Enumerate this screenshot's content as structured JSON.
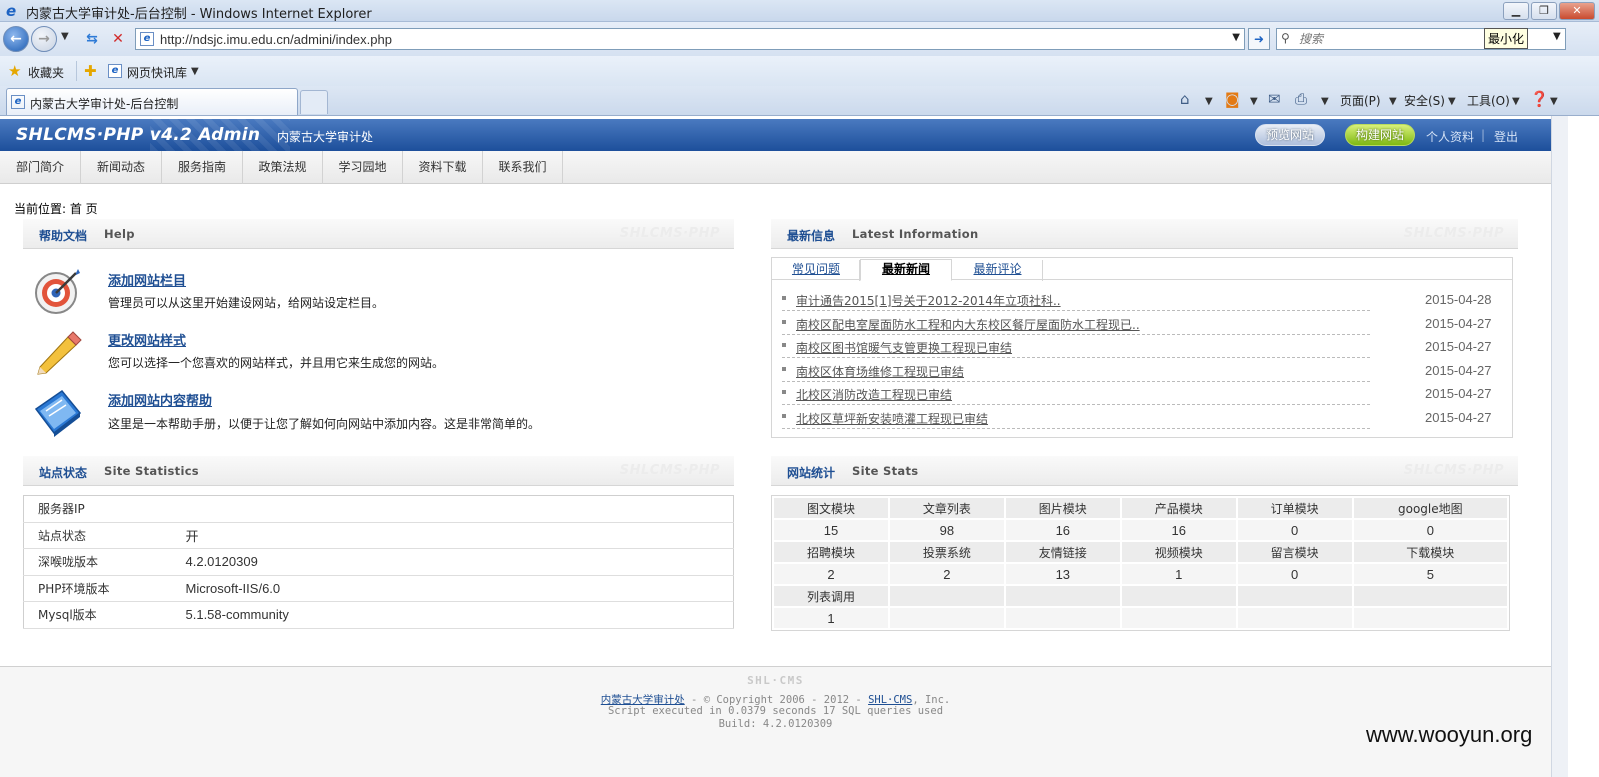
{
  "window": {
    "title": "内蒙古大学审计处-后台控制 - Windows Internet Explorer",
    "min_btn": "▁",
    "max_btn": "❐",
    "close_btn": "✕"
  },
  "address": {
    "url": "http://ndsjc.imu.edu.cn/admini/index.php",
    "search_placeholder": "搜索",
    "tooltip": "最小化"
  },
  "favorites": {
    "label": "收藏夹",
    "slice_label": "网页快讯库"
  },
  "tabs": {
    "active_title": "内蒙古大学审计处-后台控制"
  },
  "commands": {
    "page": "页面(P)",
    "safety": "安全(S)",
    "tools": "工具(O)"
  },
  "cms": {
    "logo": "SHLCMS·PHP v4.2 Admin",
    "site_name": "内蒙古大学审计处",
    "preview_btn": "预览网站",
    "build_btn": "构建网站",
    "profile_link": "个人资料",
    "logout_link": "登出",
    "sep": "|"
  },
  "menu": [
    "部门简介",
    "新闻动态",
    "服务指南",
    "政策法规",
    "学习园地",
    "资料下载",
    "联系我们"
  ],
  "breadcrumb": "当前位置: 首 页",
  "panels": {
    "help": {
      "cn": "帮助文档",
      "en": "Help",
      "wm": "SHLCMS·PHP"
    },
    "latest": {
      "cn": "最新信息",
      "en": "Latest  Information",
      "wm": "SHLCMS·PHP"
    },
    "status": {
      "cn": "站点状态",
      "en": "Site  Statistics",
      "wm": "SHLCMS·PHP"
    },
    "stats": {
      "cn": "网站统计",
      "en": "Site  Stats",
      "wm": "SHLCMS·PHP"
    }
  },
  "help_items": [
    {
      "title": "添加网站栏目",
      "desc": "管理员可以从这里开始建设网站，给网站设定栏目。",
      "icon": "target-icon"
    },
    {
      "title": "更改网站样式",
      "desc": "您可以选择一个您喜欢的网站样式，并且用它来生成您的网站。",
      "icon": "pencil-icon"
    },
    {
      "title": "添加网站内容帮助",
      "desc": "这里是一本帮助手册，以便于让您了解如何向网站中添加内容。这是非常简单的。",
      "icon": "book-icon"
    }
  ],
  "latest_tabs": [
    "常见问题",
    "最新新闻",
    "最新评论"
  ],
  "news": [
    {
      "title": "审计通告2015[1]号关于2012-2014年立项社科..",
      "date": "2015-04-28"
    },
    {
      "title": "南校区配电室屋面防水工程和内大东校区餐厅屋面防水工程现已..",
      "date": "2015-04-27"
    },
    {
      "title": "南校区图书馆暖气支管更换工程现已审结",
      "date": "2015-04-27"
    },
    {
      "title": "南校区体育场维修工程现已审结",
      "date": "2015-04-27"
    },
    {
      "title": "北校区消防改造工程现已审结",
      "date": "2015-04-27"
    },
    {
      "title": "北校区草坪新安装喷灌工程现已审结",
      "date": "2015-04-27"
    }
  ],
  "site_status": [
    {
      "label": "服务器IP",
      "value": ""
    },
    {
      "label": "站点状态",
      "value": "开"
    },
    {
      "label": "深喉咙版本",
      "value": "4.2.0120309"
    },
    {
      "label": "PHP环境版本",
      "value": "Microsoft-IIS/6.0"
    },
    {
      "label": "Mysql版本",
      "value": "5.1.58-community"
    }
  ],
  "stats": {
    "row1_labels": [
      "图文模块",
      "文章列表",
      "图片模块",
      "产品模块",
      "订单模块",
      "google地图"
    ],
    "row1_values": [
      "15",
      "98",
      "16",
      "16",
      "0",
      "0"
    ],
    "row2_labels": [
      "招聘模块",
      "投票系统",
      "友情链接",
      "视频模块",
      "留言模块",
      "下载模块"
    ],
    "row2_values": [
      "2",
      "2",
      "13",
      "1",
      "0",
      "5"
    ],
    "row3_labels": [
      "列表调用",
      "",
      "",
      "",
      "",
      ""
    ],
    "row3_values": [
      "1",
      "",
      "",
      "",
      "",
      ""
    ]
  },
  "footer": {
    "brand": "SHL·CMS",
    "org_link": "内蒙古大学审计处",
    "copyright_mid": " - © Copyright 2006 - 2012 - ",
    "cms_link": "SHL·CMS",
    "copyright_end": ", Inc.",
    "script_info": "Script executed in 0.0379 seconds 17 SQL queries used",
    "build": "Build: 4.2.0120309"
  },
  "watermark": "www.wooyun.org"
}
